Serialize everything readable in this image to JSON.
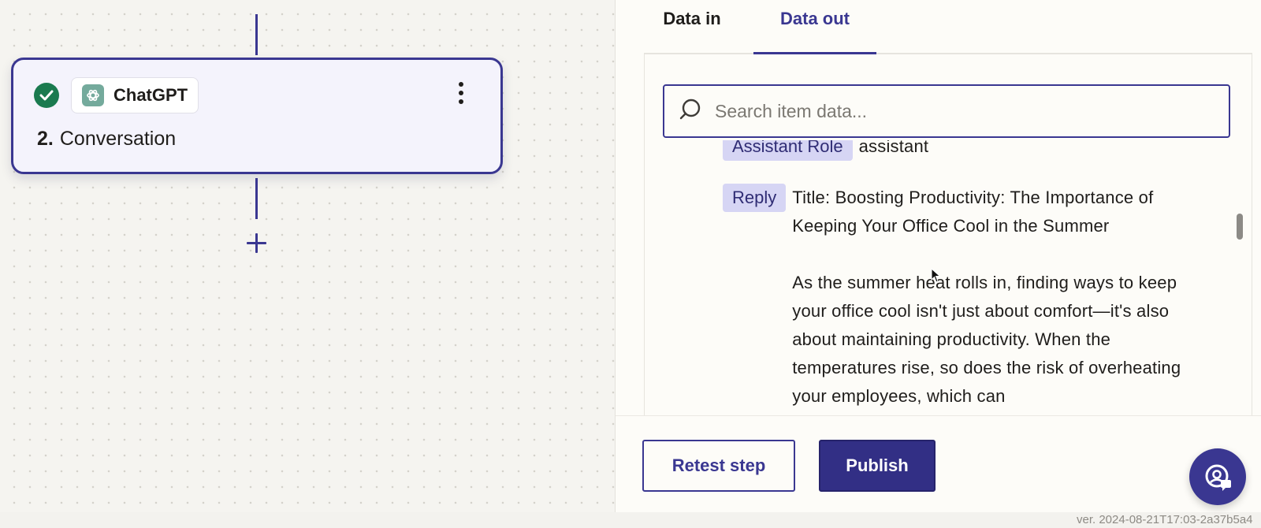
{
  "canvas": {
    "step": {
      "app_name": "ChatGPT",
      "number": "2.",
      "title": "Conversation",
      "status": "success"
    },
    "add_step_icon": "plus-icon"
  },
  "panel": {
    "tabs": [
      {
        "label": "Data in",
        "active": false
      },
      {
        "label": "Data out",
        "active": true
      }
    ],
    "search": {
      "placeholder": "Search item data..."
    },
    "data_rows": [
      {
        "key": "Assistant Role",
        "value": "assistant"
      },
      {
        "key": "Reply",
        "value": "Title: Boosting Productivity: The Importance of Keeping Your Office Cool in the Summer\n\nAs the summer heat rolls in, finding ways to keep your office cool isn't just about comfort—it's also about maintaining productivity. When the temperatures rise, so does the risk of overheating your employees, which can"
      }
    ],
    "buttons": {
      "retest": "Retest step",
      "publish": "Publish"
    },
    "help_icon": "support-chat-icon"
  },
  "footer": {
    "version": "ver. 2024-08-21T17:03-2a37b5a4"
  },
  "colors": {
    "accent": "#3a3791",
    "success": "#1a7a4f",
    "chip": "#d6d5f4",
    "chatgpt": "#74aa9c"
  }
}
